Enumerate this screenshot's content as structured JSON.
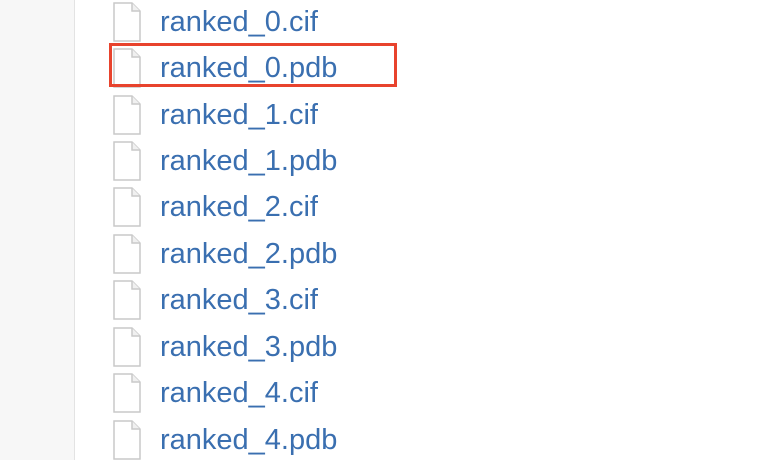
{
  "files": [
    {
      "name": "ranked_0.cif"
    },
    {
      "name": "ranked_0.pdb"
    },
    {
      "name": "ranked_1.cif"
    },
    {
      "name": "ranked_1.pdb"
    },
    {
      "name": "ranked_2.cif"
    },
    {
      "name": "ranked_2.pdb"
    },
    {
      "name": "ranked_3.cif"
    },
    {
      "name": "ranked_3.pdb"
    },
    {
      "name": "ranked_4.cif"
    },
    {
      "name": "ranked_4.pdb"
    }
  ],
  "highlighted_file": "ranked_0.pdb",
  "icon": "file-icon",
  "colors": {
    "link": "#3a6fb0",
    "highlight": "#e8432d",
    "gutter": "#f7f7f7"
  }
}
